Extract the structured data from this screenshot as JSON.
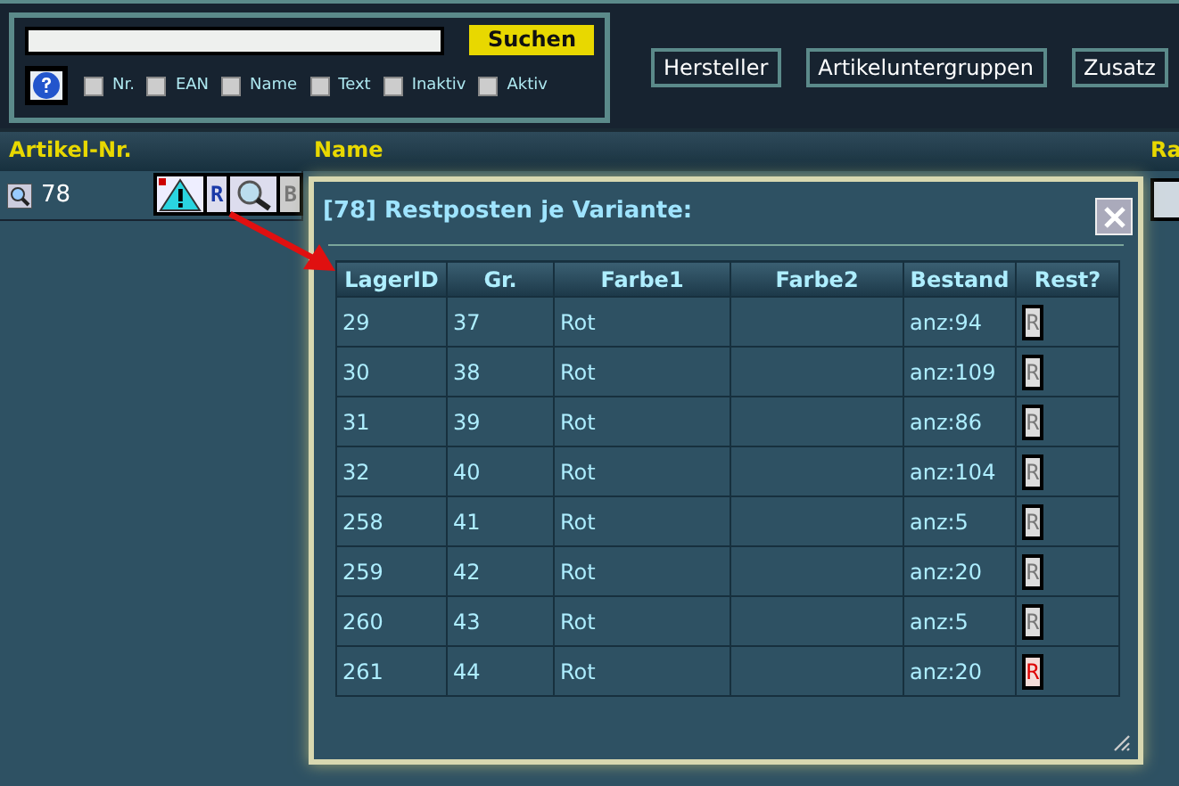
{
  "search": {
    "button": "Suchen",
    "filters": [
      {
        "label": "Nr.",
        "checked": false
      },
      {
        "label": "EAN",
        "checked": false
      },
      {
        "label": "Name",
        "checked": false
      },
      {
        "label": "Text",
        "checked": false
      },
      {
        "label": "Inaktiv",
        "checked": false
      },
      {
        "label": "Aktiv",
        "checked": false
      }
    ]
  },
  "nav_buttons": [
    "Hersteller",
    "Artikeluntergruppen",
    "Zusatz"
  ],
  "table": {
    "columns": [
      "Artikel-Nr.",
      "Name",
      "Ra"
    ],
    "rows": [
      {
        "nr": "78",
        "r_label": "R",
        "b_label": "B"
      }
    ]
  },
  "popup": {
    "title": "[78] Restposten je Variante:",
    "columns": [
      "LagerID",
      "Gr.",
      "Farbe1",
      "Farbe2",
      "Bestand",
      "Rest?"
    ],
    "rows": [
      {
        "lager": "29",
        "gr": "37",
        "farbe1": "Rot",
        "bestand": "anz:94",
        "rest": "R",
        "on": false
      },
      {
        "lager": "30",
        "gr": "38",
        "farbe1": "Rot",
        "bestand": "anz:109",
        "rest": "R",
        "on": false
      },
      {
        "lager": "31",
        "gr": "39",
        "farbe1": "Rot",
        "bestand": "anz:86",
        "rest": "R",
        "on": false
      },
      {
        "lager": "32",
        "gr": "40",
        "farbe1": "Rot",
        "bestand": "anz:104",
        "rest": "R",
        "on": false
      },
      {
        "lager": "258",
        "gr": "41",
        "farbe1": "Rot",
        "bestand": "anz:5",
        "rest": "R",
        "on": false
      },
      {
        "lager": "259",
        "gr": "42",
        "farbe1": "Rot",
        "bestand": "anz:20",
        "rest": "R",
        "on": false
      },
      {
        "lager": "260",
        "gr": "43",
        "farbe1": "Rot",
        "bestand": "anz:5",
        "rest": "R",
        "on": false
      },
      {
        "lager": "261",
        "gr": "44",
        "farbe1": "Rot",
        "bestand": "anz:20",
        "rest": "R",
        "on": true
      }
    ]
  }
}
